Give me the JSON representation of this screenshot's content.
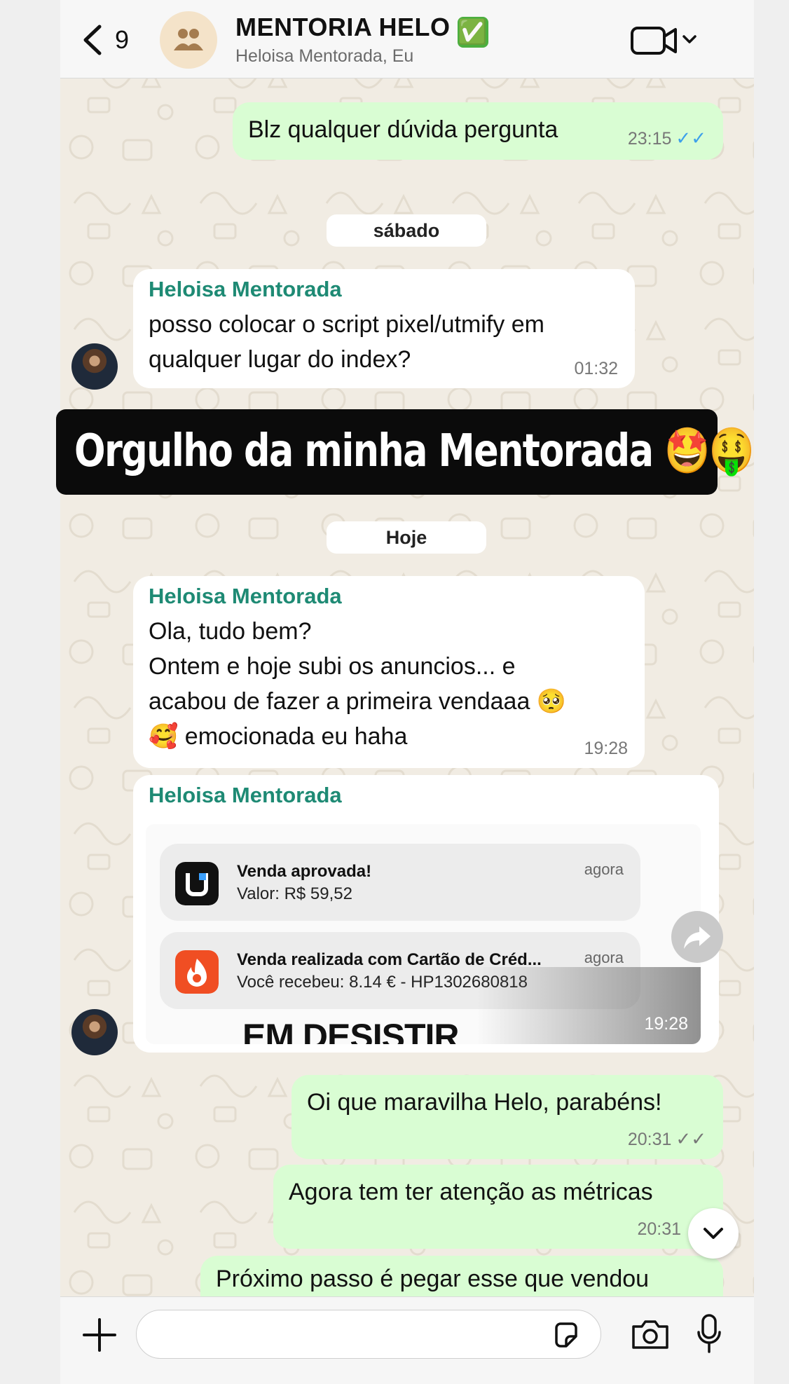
{
  "header": {
    "back_count": "9",
    "title": "MENTORIA HELO",
    "verified_badge": "✅",
    "subtitle": "Heloisa Mentorada, Eu",
    "icons": [
      "chevron-left-icon",
      "group-icon",
      "video-call-icon",
      "chevron-down-icon"
    ]
  },
  "messages": {
    "m1": {
      "text": "Blz qualquer dúvida pergunta",
      "time": "23:15"
    },
    "date1": "sábado",
    "m2": {
      "sender": "Heloisa Mentorada",
      "text_line1": "posso colocar o script pixel/utmify em",
      "text_line2": "qualquer lugar do index?",
      "time": "01:32"
    },
    "banner": "Orgulho da minha Mentorada 🤩🤑",
    "date2": "Hoje",
    "m3": {
      "sender": "Heloisa Mentorada",
      "line1": "Ola, tudo bem?",
      "line2": "Ontem e hoje subi os anuncios... e",
      "line3": "acabou de fazer a primeira vendaaa 🥺",
      "line4": "🥰 emocionada eu haha",
      "time": "19:28"
    },
    "m4": {
      "sender": "Heloisa Mentorada",
      "time": "19:28",
      "overlay_text": "EM DESISTIR",
      "notifications": [
        {
          "title": "Venda aprovada!",
          "body": "Valor: R$ 59,52",
          "when": "agora",
          "icon": "utmify-app-icon"
        },
        {
          "title": "Venda realizada com Cartão de Créd...",
          "body": "Você recebeu: 8.14 € - HP1302680818",
          "when": "agora",
          "icon": "hotmart-app-icon"
        }
      ]
    },
    "m5": {
      "text": "Oi que maravilha Helo, parabéns!",
      "time": "20:31"
    },
    "m6": {
      "text": "Agora tem ter atenção as métricas",
      "time": "20:31"
    },
    "m7": {
      "text": "Próximo passo é pegar esse que vendou"
    }
  },
  "footer": {
    "input_placeholder": "",
    "icons": [
      "plus-icon",
      "sticker-icon",
      "camera-icon",
      "microphone-icon"
    ]
  },
  "colors": {
    "outgoing_bubble": "#d9fdd3",
    "sender_name": "#1e8a74",
    "read_ticks": "#3da0ea",
    "wallpaper": "#f1ece3"
  }
}
